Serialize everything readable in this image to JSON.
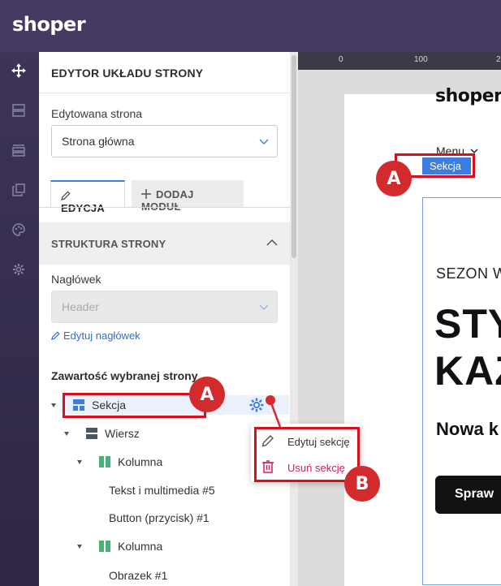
{
  "app": {
    "logo": "shoper"
  },
  "rail": {
    "icons": [
      "move-icon",
      "layout-icon",
      "sections-icon",
      "pages-icon",
      "palette-icon",
      "settings-icon"
    ]
  },
  "editor": {
    "title": "EDYTOR UKŁADU STRONY",
    "edited_page_label": "Edytowana strona",
    "edited_page_value": "Strona główna",
    "tabs": [
      {
        "label": "EDYCJA",
        "active": true
      },
      {
        "label": "DODAJ MODUŁ",
        "active": false
      }
    ],
    "structure": {
      "title": "STRUKTURA STRONY",
      "header_label": "Nagłówek",
      "header_value": "Header",
      "edit_header_link": "Edytuj nagłówek",
      "content_title": "Zawartość wybranej strony",
      "tree": [
        {
          "label": "Sekcja",
          "type": "section",
          "level": 0
        },
        {
          "label": "Wiersz",
          "type": "row",
          "level": 1
        },
        {
          "label": "Kolumna",
          "type": "column",
          "level": 2
        },
        {
          "label": "Tekst i multimedia #5",
          "type": "module",
          "level": 3
        },
        {
          "label": "Button (przycisk) #1",
          "type": "module",
          "level": 3
        },
        {
          "label": "Kolumna",
          "type": "column",
          "level": 2
        },
        {
          "label": "Obrazek #1",
          "type": "module",
          "level": 3
        }
      ]
    }
  },
  "context_menu": {
    "edit_label": "Edytuj sekcję",
    "delete_label": "Usuń sekcję"
  },
  "canvas": {
    "ruler_labels": [
      "0",
      "100",
      "2"
    ],
    "store_logo": "shoper",
    "menu_label": "Menu",
    "section_badge": "Sekcja",
    "hero_subtitle": "SEZON W",
    "hero_line1": "STY",
    "hero_line2": "KAZ",
    "hero_desc": "Nowa k",
    "hero_button": "Spraw"
  },
  "annotations": {
    "a_label": "A",
    "b_label": "B"
  },
  "colors": {
    "topbar": "#443a62",
    "accent_blue": "#3b7de0",
    "annotation_red": "#d8101e",
    "delete_red": "#d81b60"
  }
}
